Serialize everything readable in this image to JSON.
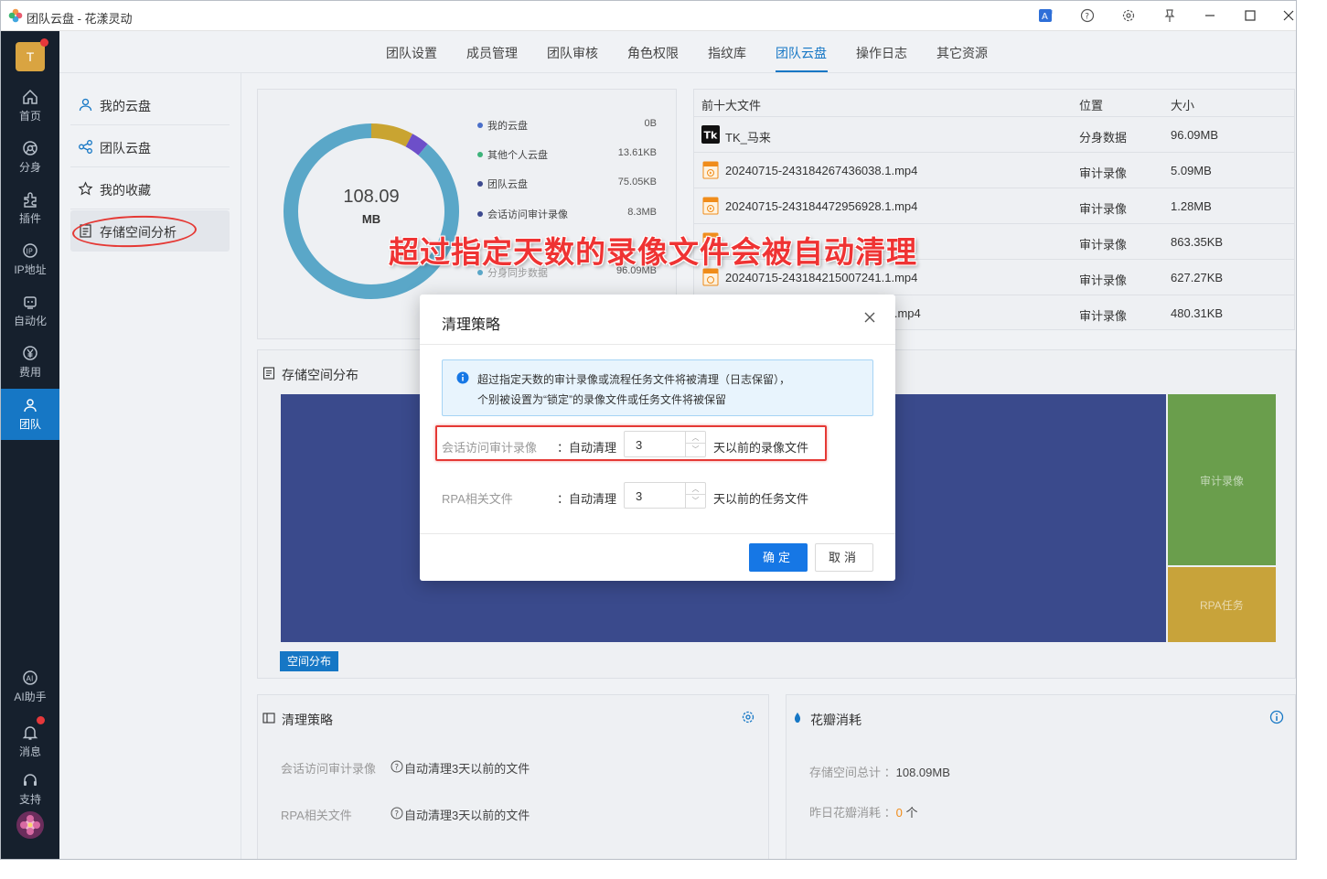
{
  "window": {
    "title": "团队云盘 - 花漾灵动"
  },
  "leftnav": {
    "avatar_letter": "T",
    "items": [
      {
        "label": "首页",
        "icon": "home-icon"
      },
      {
        "label": "分身",
        "icon": "browser-icon"
      },
      {
        "label": "插件",
        "icon": "plugin-icon"
      },
      {
        "label": "IP地址",
        "icon": "ip-icon"
      },
      {
        "label": "自动化",
        "icon": "robot-icon"
      },
      {
        "label": "费用",
        "icon": "yen-icon"
      },
      {
        "label": "团队",
        "icon": "team-icon"
      }
    ],
    "bottom_items": [
      {
        "label": "AI助手",
        "icon": "ai-icon"
      },
      {
        "label": "消息",
        "icon": "bell-icon"
      },
      {
        "label": "支持",
        "icon": "headset-icon"
      }
    ]
  },
  "toptabs": [
    "团队设置",
    "成员管理",
    "团队审核",
    "角色权限",
    "指纹库",
    "团队云盘",
    "操作日志",
    "其它资源"
  ],
  "subnav": [
    "我的云盘",
    "团队云盘",
    "我的收藏",
    "存储空间分析"
  ],
  "donut": {
    "center_value": "108.09",
    "center_unit": "MB",
    "legend": [
      {
        "label": "我的云盘",
        "value": "0B",
        "color": "#4a6fc9"
      },
      {
        "label": "其他个人云盘",
        "value": "13.61KB",
        "color": "#3db37a"
      },
      {
        "label": "团队云盘",
        "value": "75.05KB",
        "color": "#3d4a8f"
      },
      {
        "label": "会话访问审计录像",
        "value": "8.3MB",
        "color": "#3d4a8f"
      },
      {
        "label": "分身同步数据",
        "value": "96.09MB",
        "color": "#5aa7c8"
      }
    ]
  },
  "files": {
    "headers": {
      "name": "前十大文件",
      "location": "位置",
      "size": "大小"
    },
    "rows": [
      {
        "name": "TK_马来",
        "location": "分身数据",
        "size": "96.09MB"
      },
      {
        "name": "20240715-243184267436038.1.mp4",
        "location": "审计录像",
        "size": "5.09MB"
      },
      {
        "name": "20240715-243184472956928.1.mp4",
        "location": "审计录像",
        "size": "1.28MB"
      },
      {
        "name": "",
        "location": "审计录像",
        "size": "863.35KB"
      },
      {
        "name": "20240715-243184215007241.1.mp4",
        "location": "审计录像",
        "size": "627.27KB"
      },
      {
        "name": ".1.mp4",
        "location": "审计录像",
        "size": "480.31KB"
      }
    ]
  },
  "distribution": {
    "title": "存储空间分布",
    "blocks": [
      "审计录像",
      "RPA任务"
    ],
    "tag": "空间分布"
  },
  "cleanup": {
    "title": "清理策略",
    "rows": [
      {
        "label": "会话访问审计录像",
        "value": "自动清理3天以前的文件"
      },
      {
        "label": "RPA相关文件",
        "value": "自动清理3天以前的文件"
      }
    ]
  },
  "petal": {
    "title": "花瓣消耗",
    "rows": [
      {
        "label": "存储空间总计 ：",
        "value": "108.09MB"
      },
      {
        "label": "昨日花瓣消耗 ：",
        "value": "0",
        "unit": "个"
      }
    ]
  },
  "annotation": "超过指定天数的录像文件会被自动清理",
  "dialog": {
    "title": "清理策略",
    "alert_line1": "超过指定天数的审计录像或流程任务文件将被清理（日志保留），",
    "alert_line2": "个别被设置为“锁定”的录像文件或任务文件将被保留",
    "rows": [
      {
        "label": "会话访问审计录像",
        "colon": "：自动清理",
        "value": "3",
        "suffix": "天以前的录像文件"
      },
      {
        "label": "RPA相关文件",
        "colon": "：自动清理",
        "value": "3",
        "suffix": "天以前的任务文件"
      }
    ],
    "ok_label": "确定",
    "cancel_label": "取消"
  },
  "colors": {
    "accent": "#1677c5",
    "highlight": "#e53935"
  }
}
